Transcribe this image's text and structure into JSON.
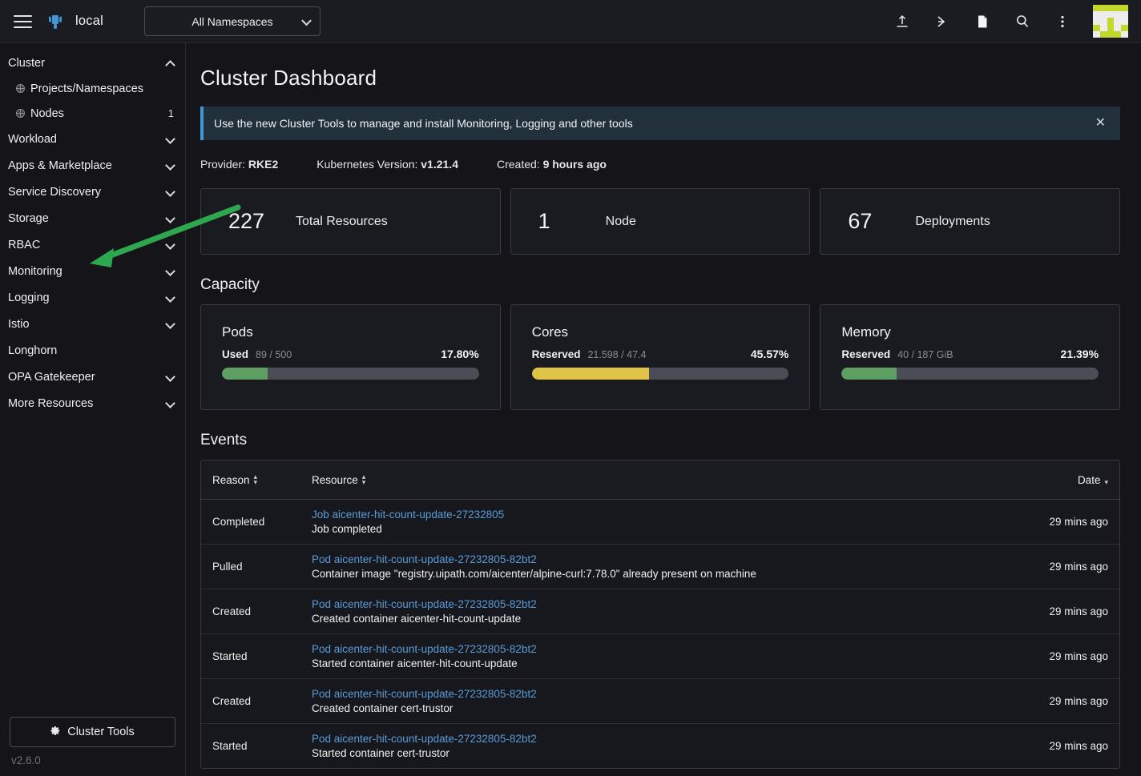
{
  "topbar": {
    "menu_icon": "hamburger-icon",
    "cluster_icon": "rancher-cow-icon",
    "cluster_name": "local",
    "namespace_filter": {
      "value": "All Namespaces",
      "chevron": "chevron-down-icon"
    },
    "actions": [
      {
        "name": "import-yaml-icon",
        "glyph": "upload"
      },
      {
        "name": "kubectl-shell-icon",
        "glyph": "shell"
      },
      {
        "name": "docs-icon",
        "glyph": "file"
      },
      {
        "name": "search-icon",
        "glyph": "magnifier"
      },
      {
        "name": "overflow-menu-icon",
        "glyph": "kebab"
      }
    ],
    "avatar_label": "user-avatar"
  },
  "sidebar": {
    "items": [
      {
        "label": "Cluster",
        "type": "group",
        "expanded": true,
        "chevron": "chevron-up-icon"
      },
      {
        "label": "Projects/Namespaces",
        "type": "child",
        "icon": "globe-icon",
        "count": ""
      },
      {
        "label": "Nodes",
        "type": "child",
        "icon": "globe-icon",
        "count": "1"
      },
      {
        "label": "Workload",
        "type": "group",
        "expanded": false,
        "chevron": "chevron-down-icon"
      },
      {
        "label": "Apps & Marketplace",
        "type": "group",
        "expanded": false,
        "chevron": "chevron-down-icon"
      },
      {
        "label": "Service Discovery",
        "type": "group",
        "expanded": false,
        "chevron": "chevron-down-icon"
      },
      {
        "label": "Storage",
        "type": "group",
        "expanded": false,
        "chevron": "chevron-down-icon"
      },
      {
        "label": "RBAC",
        "type": "group",
        "expanded": false,
        "chevron": "chevron-down-icon"
      },
      {
        "label": "Monitoring",
        "type": "group",
        "expanded": false,
        "chevron": "chevron-down-icon"
      },
      {
        "label": "Logging",
        "type": "group",
        "expanded": false,
        "chevron": "chevron-down-icon"
      },
      {
        "label": "Istio",
        "type": "group",
        "expanded": false,
        "chevron": "chevron-down-icon"
      },
      {
        "label": "Longhorn",
        "type": "group",
        "expanded": false,
        "chevron": ""
      },
      {
        "label": "OPA Gatekeeper",
        "type": "group",
        "expanded": false,
        "chevron": "chevron-down-icon"
      },
      {
        "label": "More Resources",
        "type": "group",
        "expanded": false,
        "chevron": "chevron-down-icon"
      }
    ],
    "cluster_tools_button": "Cluster Tools",
    "cluster_tools_icon": "gear-icon",
    "version": "v2.6.0"
  },
  "main": {
    "title": "Cluster Dashboard",
    "banner": {
      "message": "Use the new Cluster Tools to manage and install Monitoring, Logging and other tools",
      "close_icon": "close-icon",
      "accent_color": "#3d98d3"
    },
    "meta": [
      {
        "key": "Provider:",
        "value": "RKE2"
      },
      {
        "key": "Kubernetes Version:",
        "value": "v1.21.4"
      },
      {
        "key": "Created:",
        "value": "9 hours ago"
      }
    ],
    "counts": [
      {
        "value": "227",
        "label": "Total Resources"
      },
      {
        "value": "1",
        "label": "Node"
      },
      {
        "value": "67",
        "label": "Deployments"
      }
    ],
    "capacity": {
      "title": "Capacity",
      "cards": [
        {
          "title": "Pods",
          "key": "Used",
          "value": "89 / 500",
          "percent": "17.80%",
          "fill": 17.8,
          "color": "#5d9e62"
        },
        {
          "title": "Cores",
          "key": "Reserved",
          "value": "21.598 / 47.4",
          "percent": "45.57%",
          "fill": 45.57,
          "color": "#e0c448"
        },
        {
          "title": "Memory",
          "key": "Reserved",
          "value": "40 / 187 GiB",
          "percent": "21.39%",
          "fill": 21.39,
          "color": "#5d9e62"
        }
      ]
    },
    "events": {
      "title": "Events",
      "columns": [
        {
          "label": "Reason",
          "sortable": true,
          "sort": "none"
        },
        {
          "label": "Resource",
          "sortable": true,
          "sort": "none"
        },
        {
          "label": "Date",
          "sortable": true,
          "sort": "desc"
        }
      ],
      "rows": [
        {
          "reason": "Completed",
          "resource": "Job aicenter-hit-count-update-27232805",
          "message": "Job completed",
          "date": "29 mins ago"
        },
        {
          "reason": "Pulled",
          "resource": "Pod aicenter-hit-count-update-27232805-82bt2",
          "message": "Container image \"registry.uipath.com/aicenter/alpine-curl:7.78.0\" already present on machine",
          "date": "29 mins ago"
        },
        {
          "reason": "Created",
          "resource": "Pod aicenter-hit-count-update-27232805-82bt2",
          "message": "Created container aicenter-hit-count-update",
          "date": "29 mins ago"
        },
        {
          "reason": "Started",
          "resource": "Pod aicenter-hit-count-update-27232805-82bt2",
          "message": "Started container aicenter-hit-count-update",
          "date": "29 mins ago"
        },
        {
          "reason": "Created",
          "resource": "Pod aicenter-hit-count-update-27232805-82bt2",
          "message": "Created container cert-trustor",
          "date": "29 mins ago"
        },
        {
          "reason": "Started",
          "resource": "Pod aicenter-hit-count-update-27232805-82bt2",
          "message": "Started container cert-trustor",
          "date": "29 mins ago"
        }
      ]
    }
  },
  "annotation": {
    "arrow_color": "#2ea84f",
    "points_to": "Monitoring"
  }
}
